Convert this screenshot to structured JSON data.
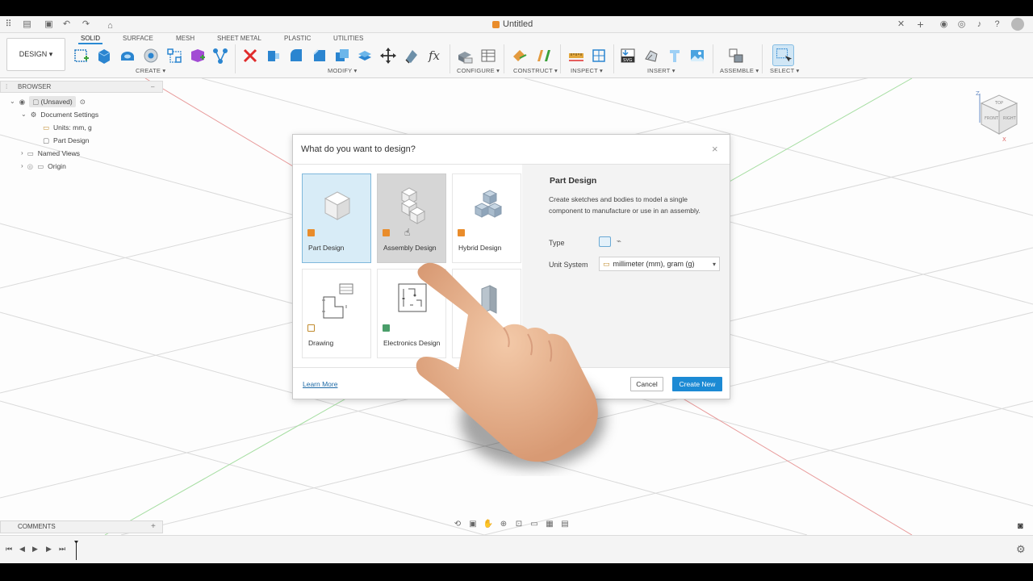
{
  "window": {
    "doc_title": "Untitled"
  },
  "toolbar": {
    "workspace_button": "DESIGN ▾",
    "tabs": [
      "SOLID",
      "SURFACE",
      "MESH",
      "SHEET METAL",
      "PLASTIC",
      "UTILITIES"
    ],
    "active_tab": "SOLID",
    "groups": [
      "CREATE ▾",
      "MODIFY ▾",
      "CONFIGURE ▾",
      "CONSTRUCT ▾",
      "INSPECT ▾",
      "INSERT ▾",
      "ASSEMBLE ▾",
      "SELECT ▾"
    ],
    "svg_badge": "SVG"
  },
  "browser": {
    "title": "BROWSER",
    "root": "(Unsaved)",
    "items": [
      "Document Settings",
      "Units: mm, g",
      "Part Design",
      "Named Views",
      "Origin"
    ]
  },
  "viewcube": {
    "axis_z": "Z",
    "axis_x": "X",
    "face_top": "TOP",
    "face_front": "FRONT",
    "face_right": "RIGHT"
  },
  "dialog": {
    "title": "What do you want to design?",
    "close": "×",
    "cards": [
      {
        "label": "Part Design",
        "state": "selected"
      },
      {
        "label": "Assembly Design",
        "state": "hover"
      },
      {
        "label": "Hybrid Design",
        "state": "normal"
      },
      {
        "label": "Drawing",
        "state": "normal"
      },
      {
        "label": "Electronics Design",
        "state": "normal"
      },
      {
        "label": "",
        "state": "normal"
      }
    ],
    "panel": {
      "title": "Part Design",
      "description": "Create sketches and bodies to model a single component to manufacture or use in an assembly.",
      "type_label": "Type",
      "unit_label": "Unit System",
      "unit_value": "millimeter (mm), gram (g)"
    },
    "learn_more": "Learn More",
    "cancel": "Cancel",
    "create": "Create New"
  },
  "comments": {
    "label": "COMMENTS",
    "add": "+"
  },
  "colors": {
    "accent": "#1c8ad4",
    "selected_card": "#d8ecf7",
    "orange": "#e98c2b"
  }
}
